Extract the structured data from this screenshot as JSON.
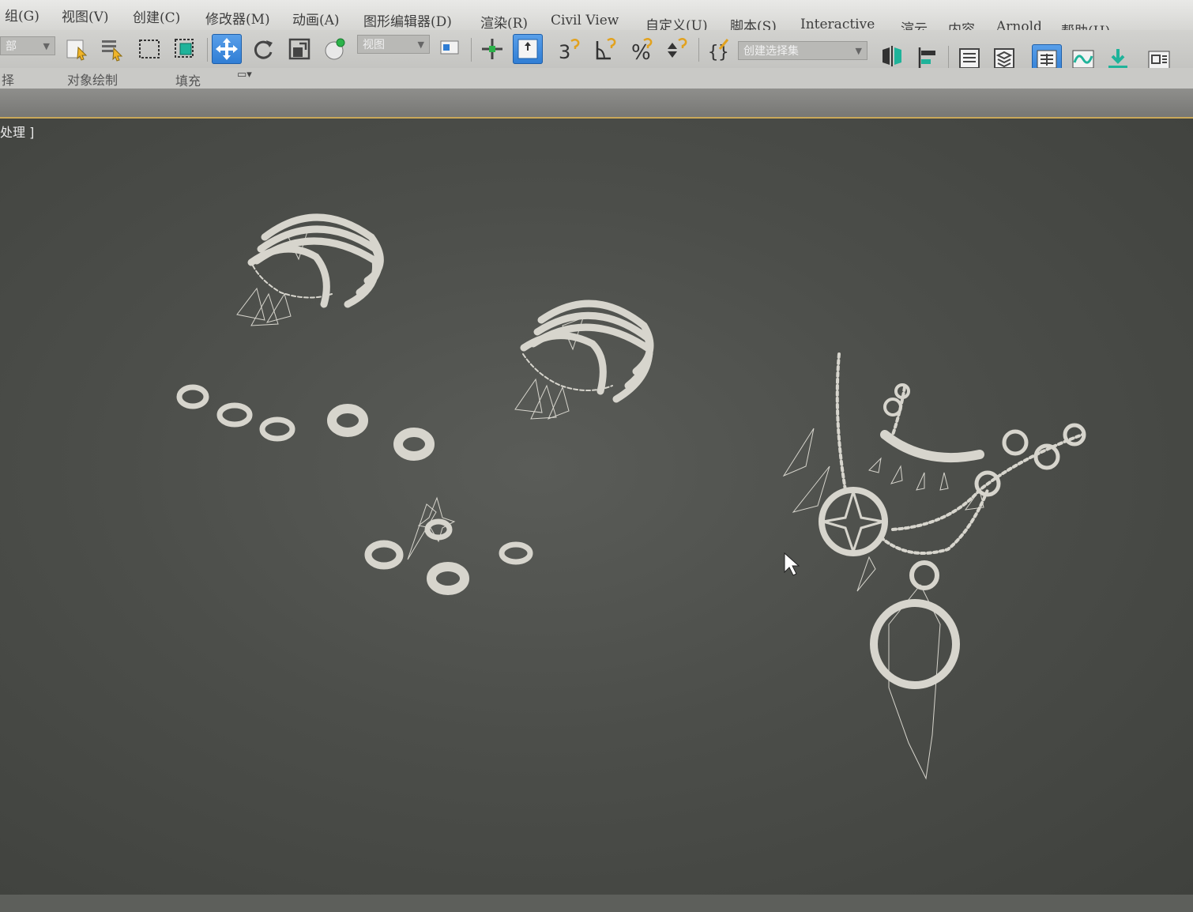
{
  "menu": {
    "items": [
      "组(G)",
      "视图(V)",
      "创建(C)",
      "修改器(M)",
      "动画(A)",
      "图形编辑器(D)",
      "渲染(R)",
      "Civil View",
      "自定义(U)",
      "脚本(S)",
      "Interactive",
      "渲云",
      "内容",
      "Arnold",
      "帮助(H)"
    ]
  },
  "toolbar": {
    "selection_filter": "部",
    "reference_coord": "视图",
    "named_selection": "创建选择集",
    "icons": [
      "select-object-icon",
      "select-by-name-icon",
      "rect-selection-region-icon",
      "window-crossing-icon",
      "select-move-icon",
      "select-rotate-icon",
      "select-scale-icon",
      "select-place-icon",
      "use-pivot-center-icon",
      "select-manipulate-icon",
      "keyboard-shortcut-override-icon",
      "snaps-toggle-icon",
      "angle-snap-icon",
      "percent-snap-icon",
      "spinner-snap-icon",
      "edit-named-selection-icon",
      "mirror-icon",
      "align-icon",
      "scene-explorer-icon",
      "layer-explorer-icon",
      "toggle-ribbon-icon",
      "curve-editor-icon",
      "schematic-view-icon",
      "render-setup-icon"
    ],
    "active": [
      "select-move-icon",
      "use-pivot-center-icon",
      "toggle-ribbon-icon"
    ]
  },
  "ribbon": {
    "tabs": [
      "择",
      "对象绘制",
      "填充"
    ]
  },
  "viewport": {
    "label": "处理 ]",
    "accent_color": "#caa85a",
    "model_color": "#d7d5cd"
  }
}
